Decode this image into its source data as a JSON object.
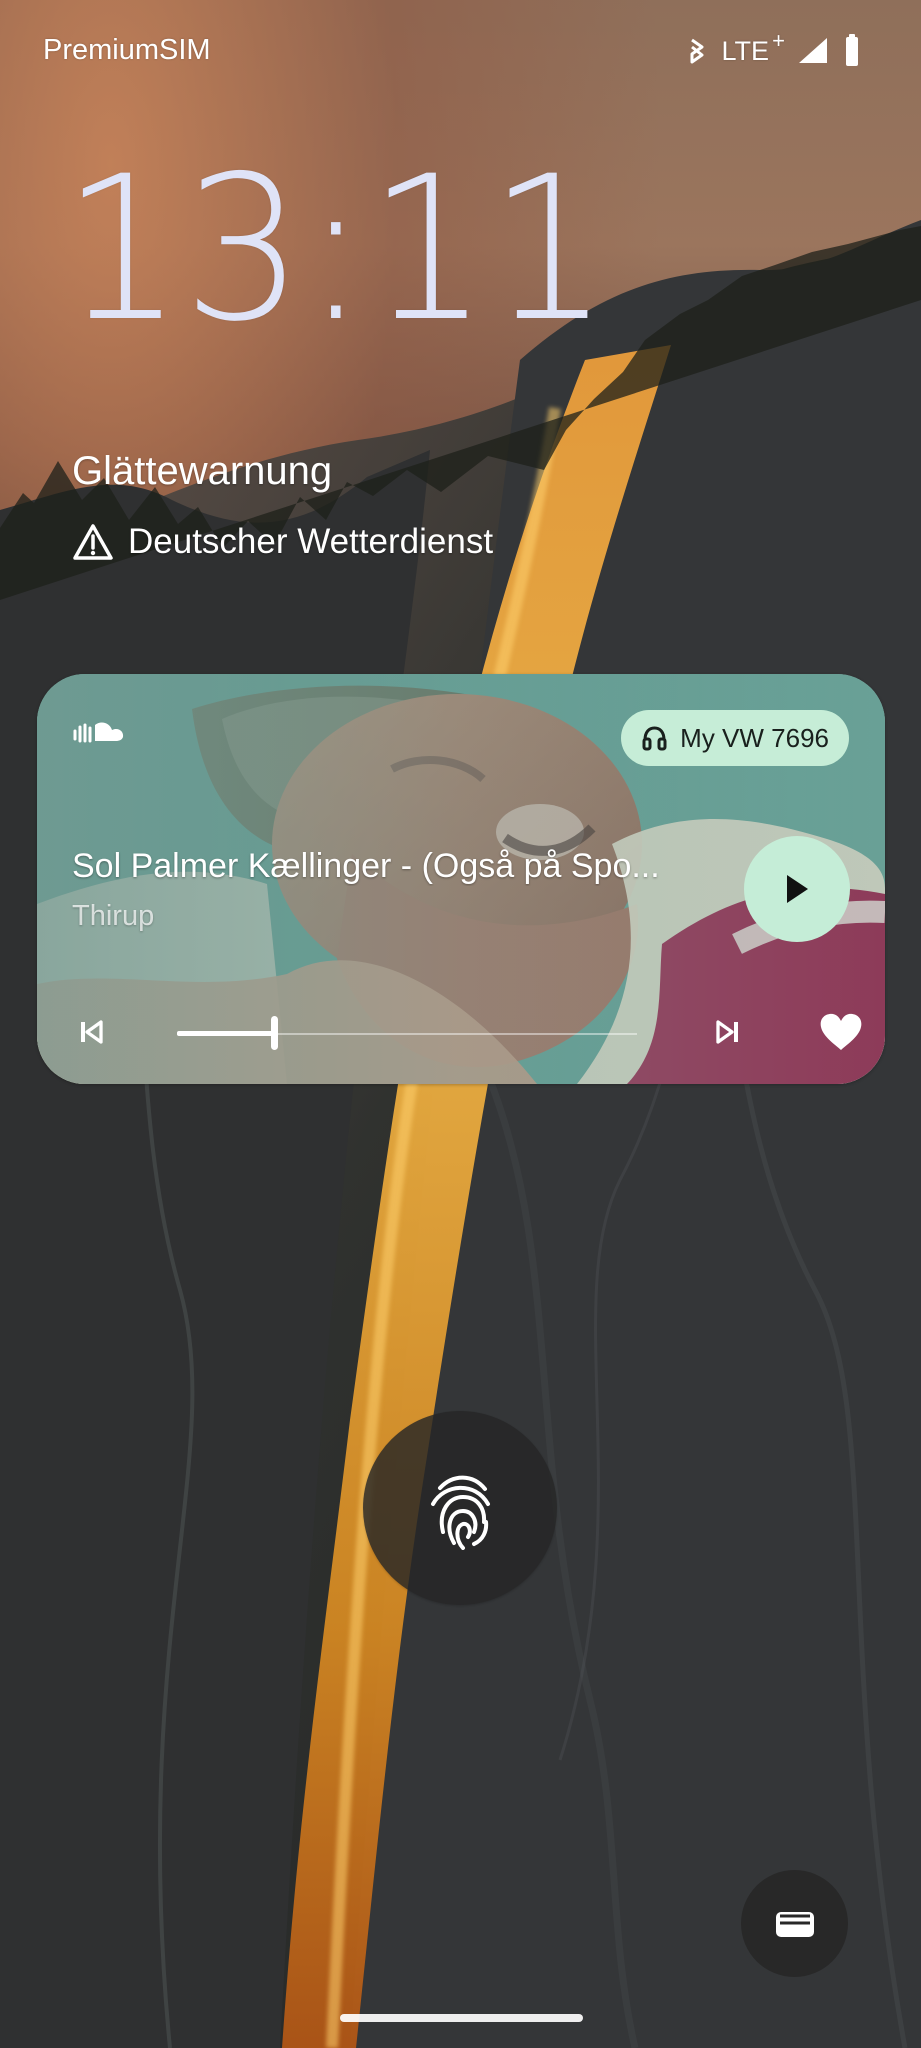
{
  "status_bar": {
    "carrier": "PremiumSIM",
    "network": "LTE",
    "network_plus": "+",
    "icons": [
      "bluetooth-icon",
      "signal-icon",
      "battery-icon"
    ]
  },
  "lock_screen": {
    "time": "13:11",
    "weather_alert": {
      "title": "Glättewarnung",
      "source": "Deutscher Wetterdienst",
      "icon": "warning-icon"
    }
  },
  "media_player": {
    "app_icon": "soundcloud-icon",
    "output_device": {
      "label": "My VW 7696",
      "icon": "headphones-icon"
    },
    "track_title": "Sol Palmer Kællinger - (Også på Spo...",
    "artist": "Thirup",
    "progress": 0.21,
    "controls": {
      "play_icon": "play-icon",
      "previous_icon": "skip-previous-icon",
      "next_icon": "skip-next-icon",
      "favorite_icon": "heart-icon"
    },
    "colors": {
      "chip": "#c6edd7",
      "play_button": "#c5edd7"
    }
  },
  "bottom_actions": {
    "unlock_icon": "fingerprint-icon",
    "wallet_icon": "wallet-icon"
  }
}
